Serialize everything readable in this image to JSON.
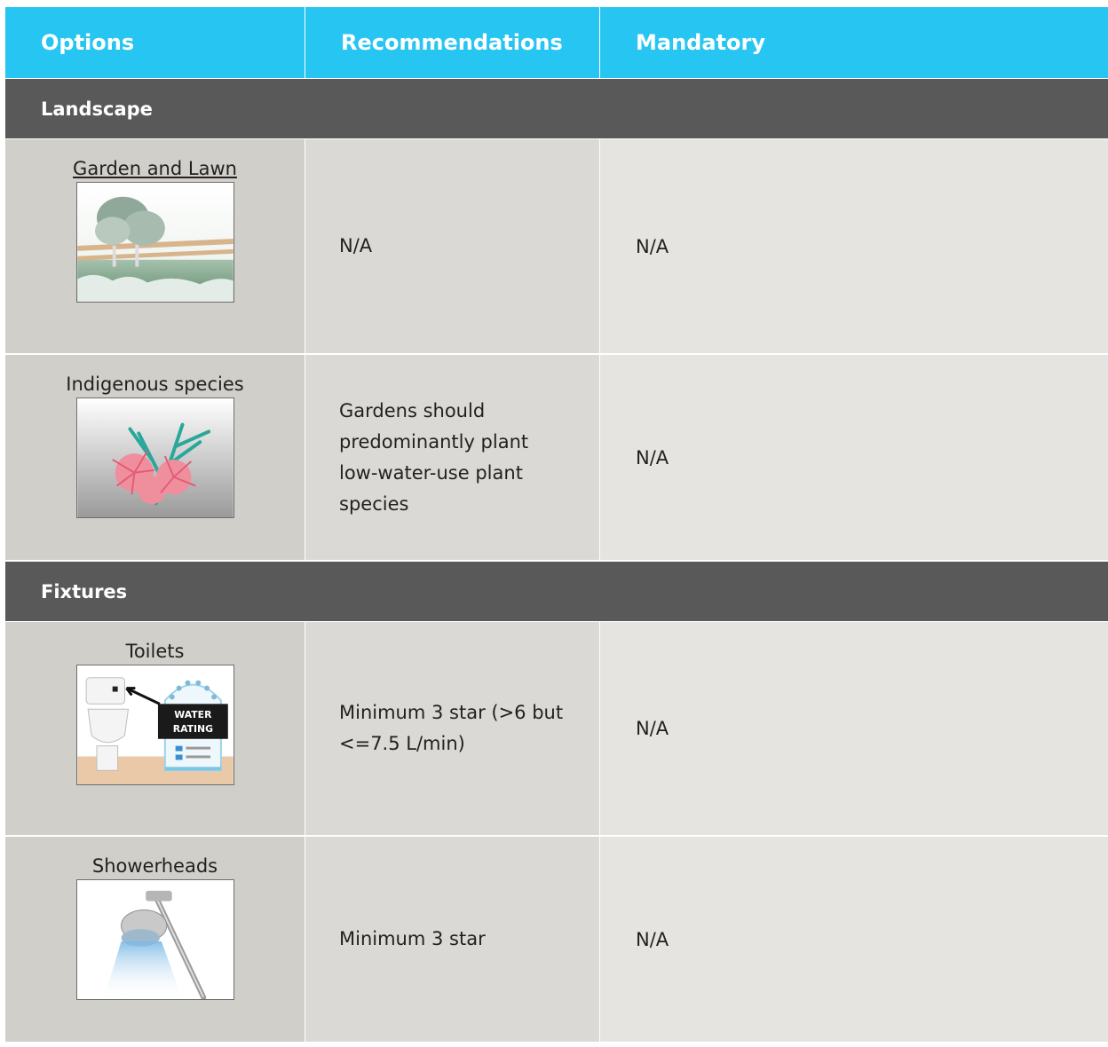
{
  "header": {
    "col1": "Options",
    "col2": "Recommendations",
    "col3": "Mandatory"
  },
  "sections": [
    {
      "title": "Landscape",
      "rows": [
        {
          "option": "Garden and Lawn",
          "recommendation": "N/A",
          "mandatory": "N/A",
          "icon": "garden-lawn-icon"
        },
        {
          "option": "Indigenous species",
          "recommendation": "Gardens should predominantly plant low-water-use plant species",
          "mandatory": "N/A",
          "icon": "flower-icon"
        }
      ]
    },
    {
      "title": "Fixtures",
      "rows": [
        {
          "option": "Toilets",
          "recommendation": "Minimum 3 star (>6 but <=7.5 L/min)",
          "mandatory": "N/A",
          "icon": "toilet-icon",
          "badge_line1": "WATER",
          "badge_line2": "RATING"
        },
        {
          "option": "Showerheads",
          "recommendation": "Minimum 3 star",
          "mandatory": "N/A",
          "icon": "showerhead-icon"
        }
      ]
    }
  ],
  "colors": {
    "header_bg": "#27c5f1",
    "section_bg": "#595959",
    "col1_bg": "#d1cfca",
    "col2_bg": "#dbd9d5",
    "col3_bg": "#e6e4e0"
  }
}
